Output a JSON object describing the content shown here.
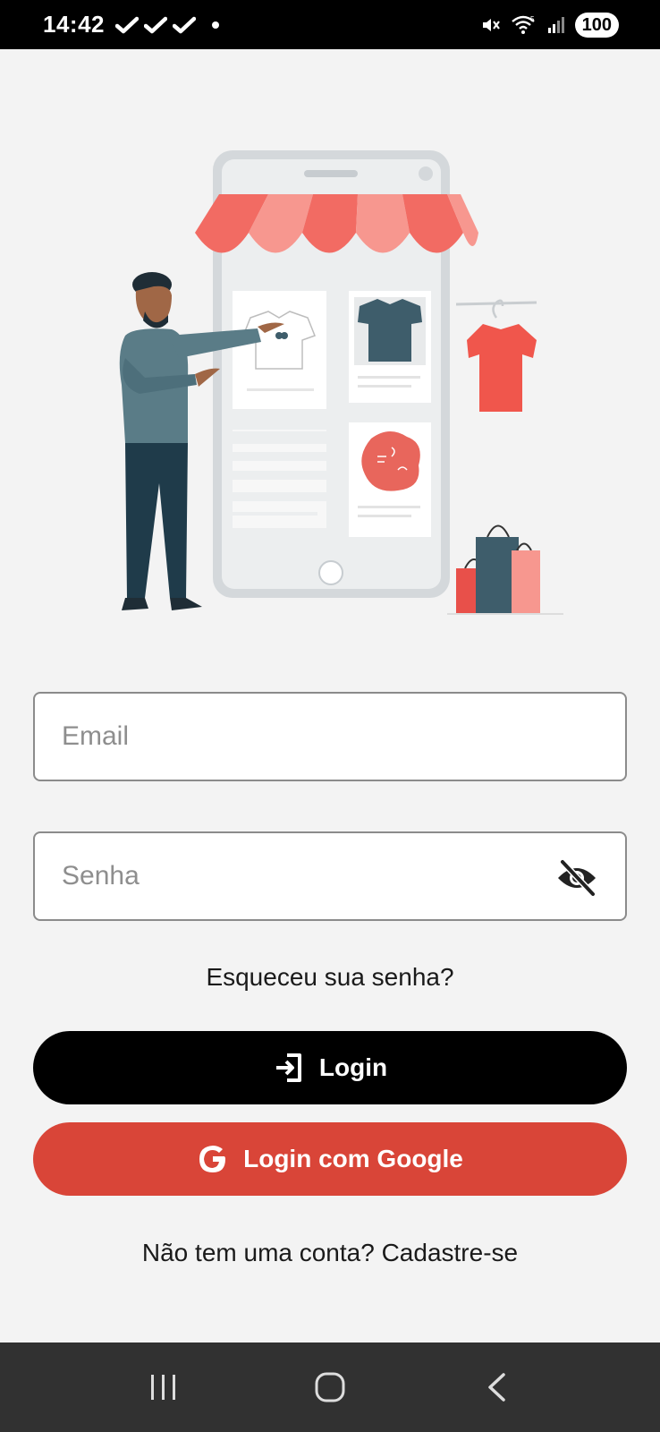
{
  "status_bar": {
    "time": "14:42",
    "battery": "100",
    "icons": [
      "check-icon",
      "check-icon",
      "check-icon",
      "dot-icon",
      "mute-icon",
      "wifi-icon",
      "signal-icon",
      "battery-icon"
    ]
  },
  "illustration": {
    "description_icon": "shop-illustration"
  },
  "form": {
    "email_placeholder": "Email",
    "password_placeholder": "Senha",
    "password_toggle_icon": "eye-off-icon"
  },
  "links": {
    "forgot_password": "Esqueceu sua senha?",
    "signup": "Não tem uma conta? Cadastre-se"
  },
  "buttons": {
    "login_label": "Login",
    "login_icon": "login-icon",
    "google_label": "Login com Google",
    "google_icon": "google-icon"
  },
  "nav_bar": {
    "items": [
      "recents-icon",
      "home-icon",
      "back-icon"
    ]
  },
  "colors": {
    "background": "#f3f3f3",
    "login_button": "#000000",
    "google_button": "#d94538",
    "awning_red": "#f26b63",
    "awning_light": "#f7978f",
    "nav_bar": "#313131"
  }
}
